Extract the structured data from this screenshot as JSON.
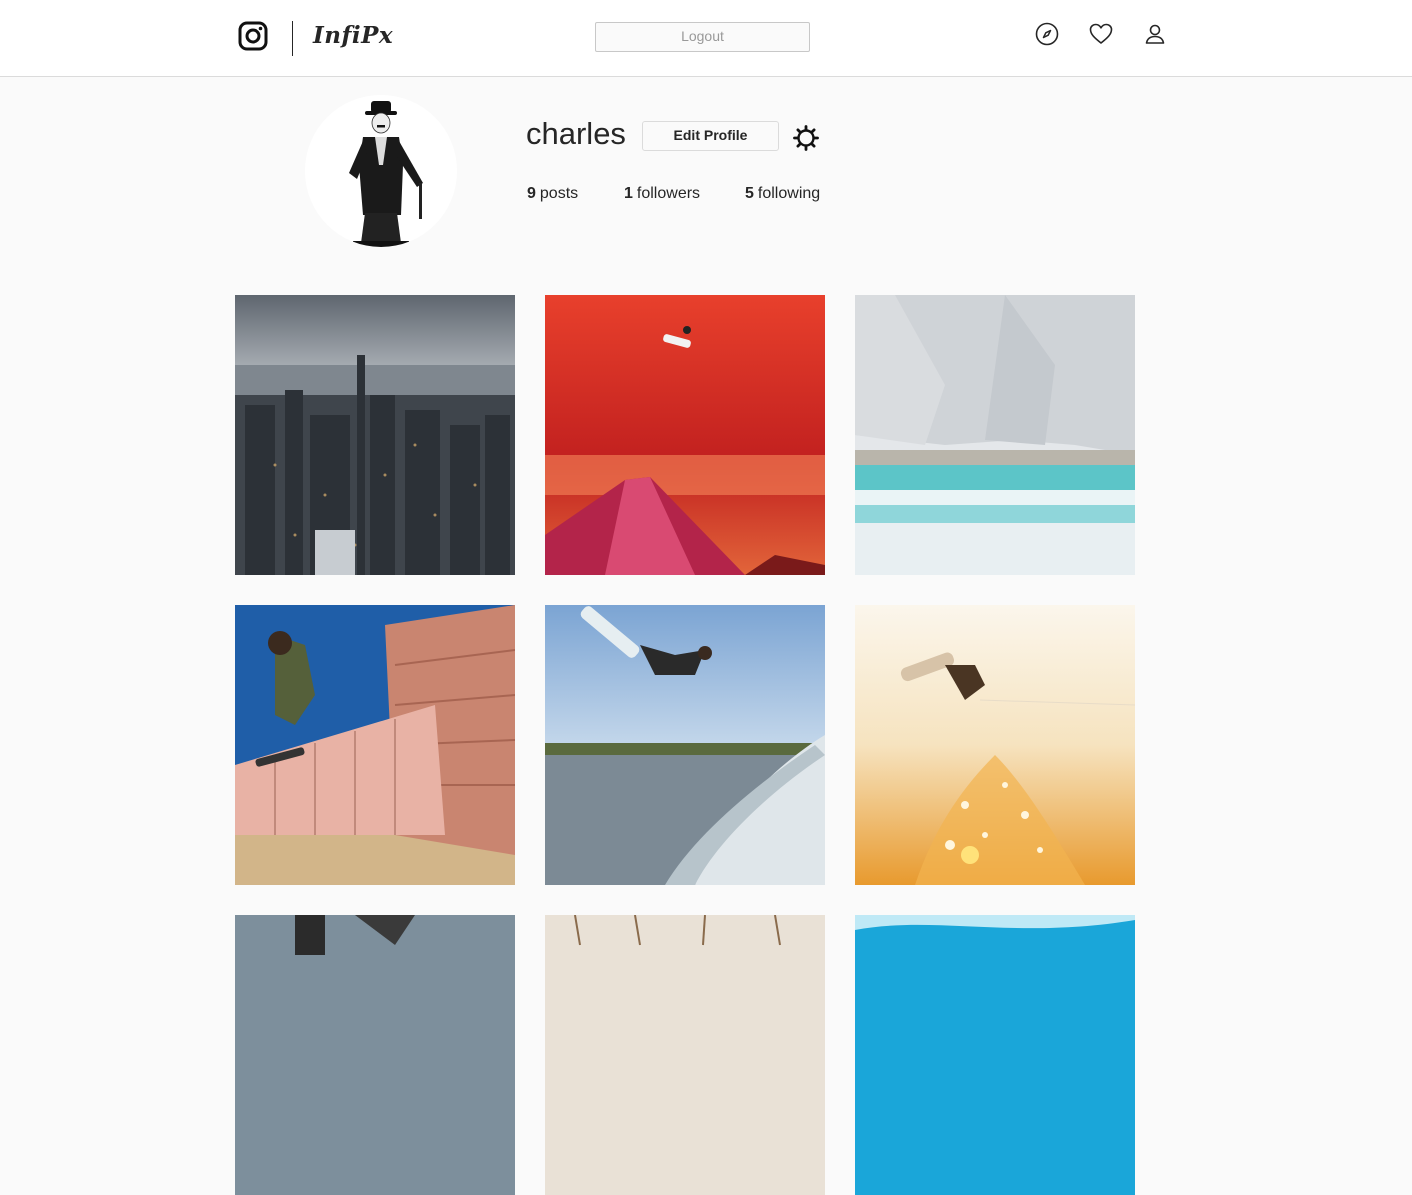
{
  "header": {
    "brand": "InfiPx",
    "logout_label": "Logout",
    "icons": [
      "instagram-icon",
      "explore-icon",
      "heart-icon",
      "user-icon"
    ]
  },
  "profile": {
    "username": "charles",
    "edit_label": "Edit Profile",
    "stats": {
      "posts_count": "9",
      "posts_label": "posts",
      "followers_count": "1",
      "followers_label": "followers",
      "following_count": "5",
      "following_label": "following"
    }
  },
  "posts": [
    {
      "subject": "city-aerial"
    },
    {
      "subject": "snowboard-red-sky"
    },
    {
      "subject": "cliff-waves"
    },
    {
      "subject": "skateboard-wall"
    },
    {
      "subject": "wakeboard-lake"
    },
    {
      "subject": "wakeboard-sunset"
    },
    {
      "subject": "palm-trees"
    },
    {
      "subject": "snow-trees"
    },
    {
      "subject": "ocean-wave"
    }
  ]
}
